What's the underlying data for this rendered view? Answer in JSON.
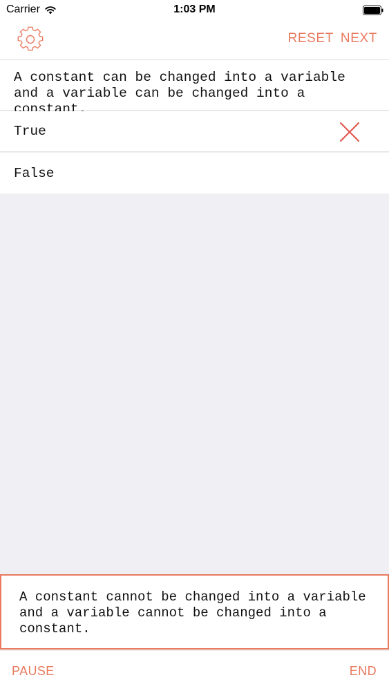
{
  "status_bar": {
    "carrier": "Carrier",
    "time": "1:03 PM",
    "wifi_icon": "wifi-icon",
    "battery_icon": "battery-icon"
  },
  "nav": {
    "settings_icon": "gear-icon",
    "reset_label": "RESET",
    "next_label": "NEXT"
  },
  "question": {
    "text": "A constant can be changed into a variable and a variable can be changed into a constant."
  },
  "answers": [
    {
      "label": "True",
      "marked_wrong": true,
      "mark_icon": "cross-icon"
    },
    {
      "label": "False",
      "marked_wrong": false
    }
  ],
  "explanation": {
    "text": "A constant cannot be changed into a variable and a variable cannot be changed into a constant."
  },
  "bottom_bar": {
    "pause_label": "PAUSE",
    "end_label": "END"
  },
  "colors": {
    "accent": "#e97a5f",
    "wrong_mark": "#e05a50",
    "background": "#efeff4"
  }
}
